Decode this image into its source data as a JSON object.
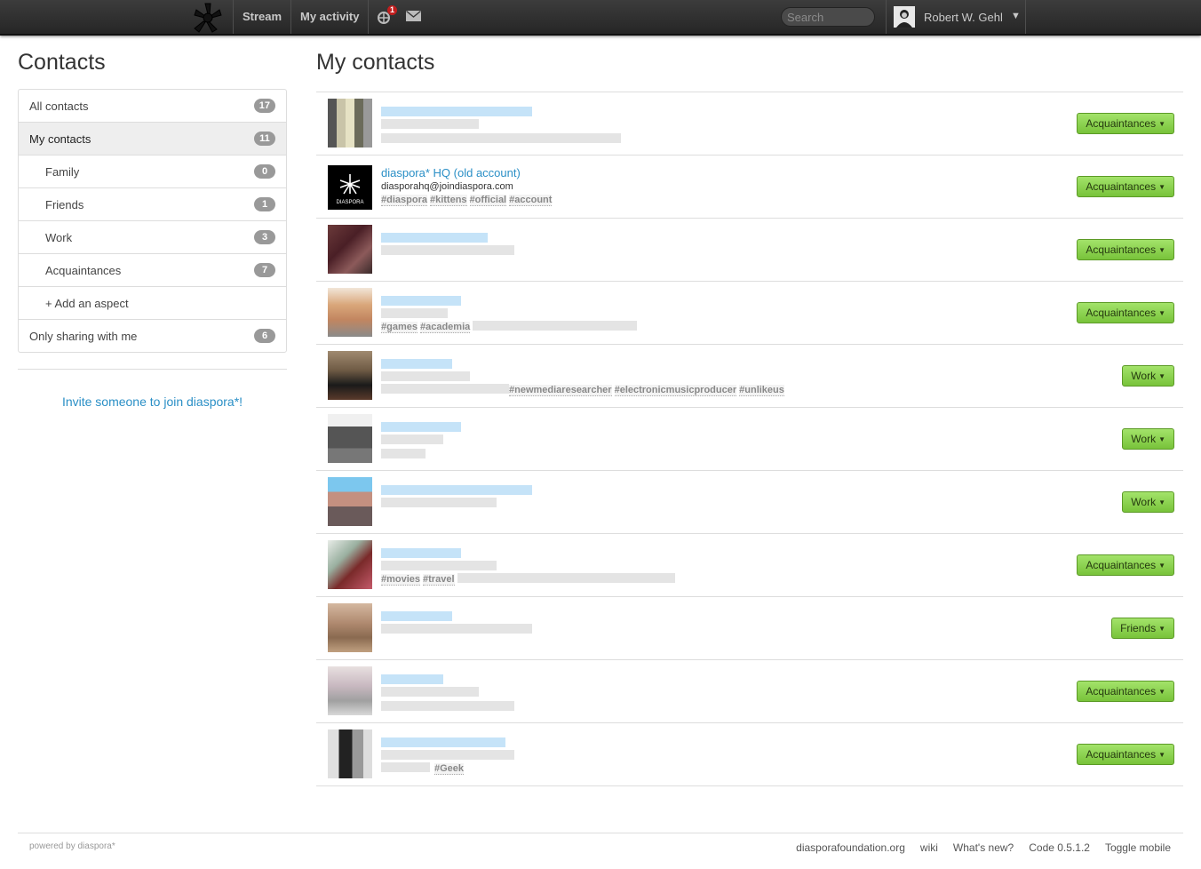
{
  "header": {
    "nav": [
      {
        "label": "Stream"
      },
      {
        "label": "My activity"
      }
    ],
    "notification_count": "1",
    "search_placeholder": "Search",
    "user_name": "Robert W. Gehl",
    "user_caret": "▼"
  },
  "sidebar": {
    "title": "Contacts",
    "items": [
      {
        "label": "All contacts",
        "count": "17"
      },
      {
        "label": "My contacts",
        "count": "11"
      },
      {
        "label": "Family",
        "count": "0"
      },
      {
        "label": "Friends",
        "count": "1"
      },
      {
        "label": "Work",
        "count": "3"
      },
      {
        "label": "Acquaintances",
        "count": "7"
      },
      {
        "label": "+ Add an aspect"
      },
      {
        "label": "Only sharing with me",
        "count": "6"
      }
    ],
    "invite": "Invite someone to join diaspora*!"
  },
  "main": {
    "title": "My contacts",
    "contacts": [
      {
        "aspect": "Acquaintances"
      },
      {
        "name": "diaspora* HQ (old account)",
        "handle": "diasporahq@joindiaspora.com",
        "tags": [
          "#diaspora",
          "#kittens",
          "#official",
          "#account"
        ],
        "aspect": "Acquaintances"
      },
      {
        "aspect": "Acquaintances"
      },
      {
        "tags": [
          "#games",
          "#academia"
        ],
        "aspect": "Acquaintances"
      },
      {
        "tags": [
          "#newmediaresearcher",
          "#electronicmusicproducer",
          "#unlikeus"
        ],
        "aspect": "Work"
      },
      {
        "aspect": "Work"
      },
      {
        "aspect": "Work"
      },
      {
        "tags": [
          "#movies",
          "#travel"
        ],
        "aspect": "Acquaintances"
      },
      {
        "aspect": "Friends"
      },
      {
        "aspect": "Acquaintances"
      },
      {
        "tags": [
          "#Geek"
        ],
        "aspect": "Acquaintances"
      }
    ]
  },
  "footer": {
    "powered": "powered by diaspora*",
    "links": [
      "diasporafoundation.org",
      "wiki",
      "What's new?",
      "Code 0.5.1.2",
      "Toggle mobile"
    ]
  }
}
